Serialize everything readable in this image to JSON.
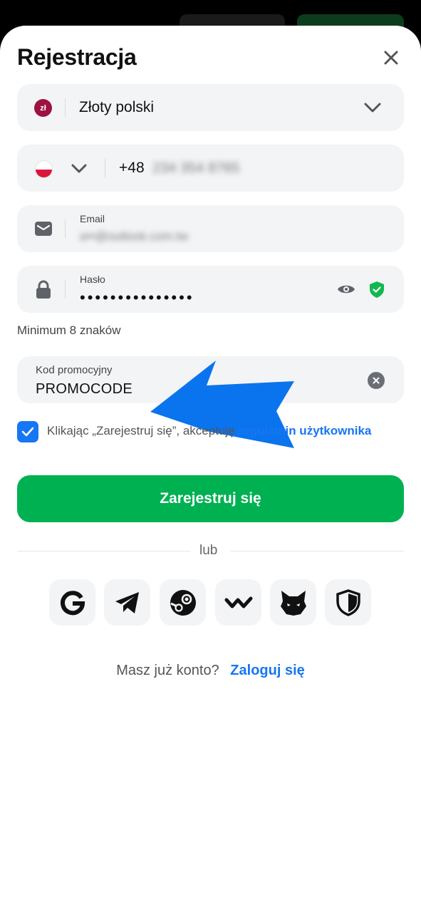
{
  "header": {
    "title": "Rejestracja",
    "close_icon": "close-icon"
  },
  "currency": {
    "badge": "zł",
    "label": "Złoty polski",
    "badge_color": "#9e1240"
  },
  "phone": {
    "country_flag": "poland-flag",
    "prefix": "+48",
    "number_blurred": "234 354 8765"
  },
  "email": {
    "label": "Email",
    "value_blurred": "a••@outlook.com.tw"
  },
  "password": {
    "label": "Hasło",
    "value_masked": "•••••••••••••••",
    "hint": "Minimum 8 znaków"
  },
  "promo": {
    "label": "Kod promocyjny",
    "value": "PROMOCODE"
  },
  "terms": {
    "checked": true,
    "text": "Klikając „Zarejestruj się”, akceptuję",
    "link": "regulamin użytkownika"
  },
  "register_button": "Zarejestruj się",
  "divider_text": "lub",
  "social_icons": [
    "google-icon",
    "telegram-icon",
    "steam-icon",
    "walletconnect-icon",
    "metamask-fox-icon",
    "shield-wallet-icon"
  ],
  "login": {
    "question": "Masz już konto?",
    "link": "Zaloguj się"
  },
  "colors": {
    "accent_blue": "#1676f3",
    "primary_green": "#00b152",
    "field_bg": "#f3f4f6",
    "verified_green": "#12b84f"
  }
}
